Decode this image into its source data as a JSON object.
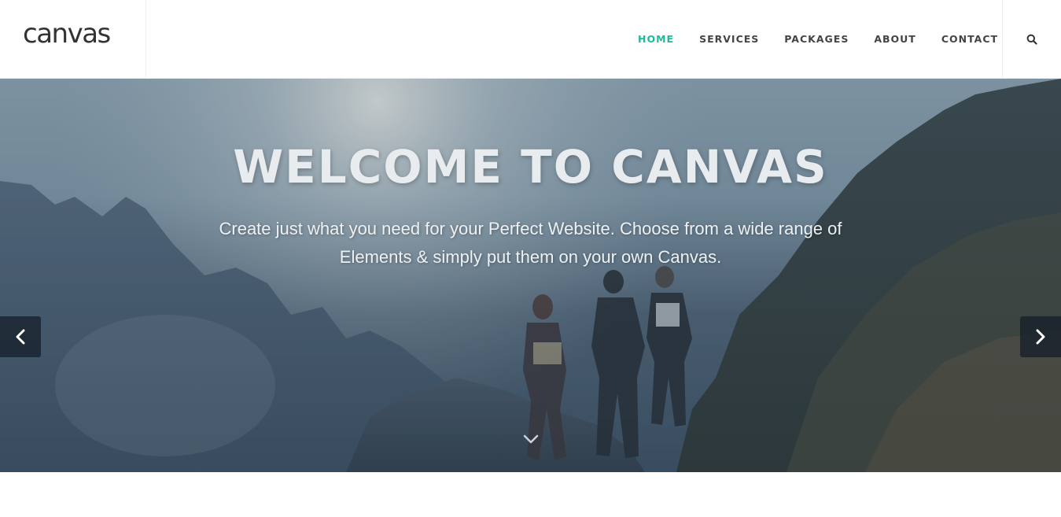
{
  "header": {
    "logo_text": "canvas",
    "nav": [
      {
        "label": "HOME",
        "active": true
      },
      {
        "label": "SERVICES",
        "active": false
      },
      {
        "label": "PACKAGES",
        "active": false
      },
      {
        "label": "ABOUT",
        "active": false
      },
      {
        "label": "CONTACT",
        "active": false
      }
    ],
    "search_icon": "search-icon"
  },
  "hero": {
    "title": "WELCOME TO CANVAS",
    "subtitle": "Create just what you need for your Perfect Website. Choose from a wide range of Elements & simply put them on your own Canvas.",
    "prev_icon": "chevron-left-icon",
    "next_icon": "chevron-right-icon",
    "scroll_icon": "chevron-down-icon"
  },
  "colors": {
    "accent": "#1ABC9C",
    "nav_text": "#444444",
    "logo": "#333333"
  }
}
